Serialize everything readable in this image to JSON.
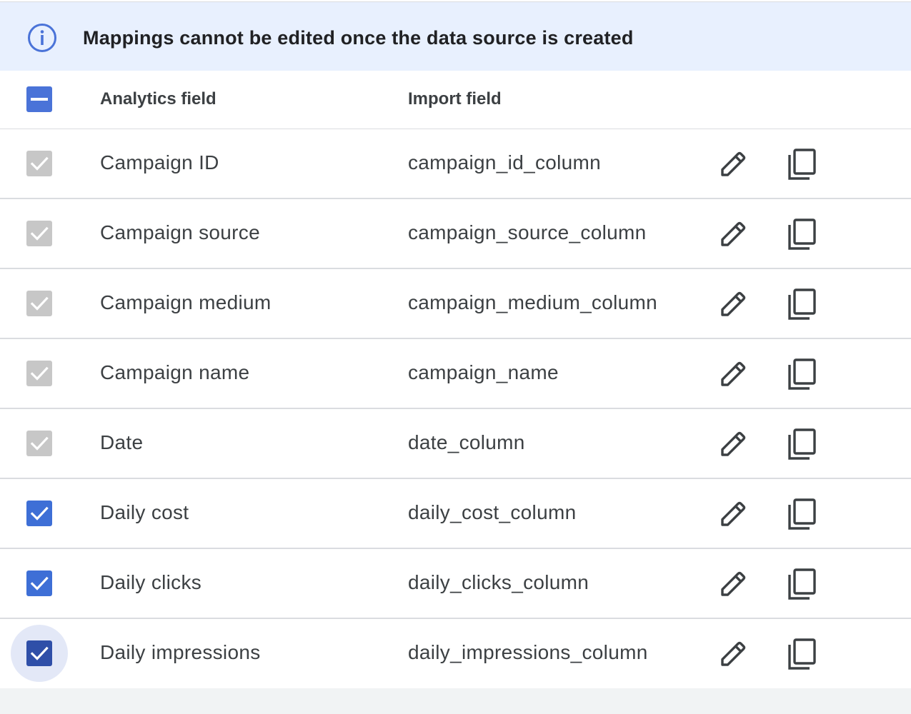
{
  "banner": {
    "icon": "info-icon",
    "text": "Mappings cannot be edited once the data source is created",
    "background": "#e8f0fe",
    "icon_color": "#4a73d8"
  },
  "table": {
    "select_all_state": "indeterminate",
    "columns": {
      "analytics": "Analytics field",
      "import": "Import field"
    },
    "rows": [
      {
        "analytics": "Campaign ID",
        "import": "campaign_id_column",
        "state": "disabled"
      },
      {
        "analytics": "Campaign source",
        "import": "campaign_source_column",
        "state": "disabled"
      },
      {
        "analytics": "Campaign medium",
        "import": "campaign_medium_column",
        "state": "disabled"
      },
      {
        "analytics": "Campaign name",
        "import": "campaign_name",
        "state": "disabled"
      },
      {
        "analytics": "Date",
        "import": "date_column",
        "state": "disabled"
      },
      {
        "analytics": "Daily cost",
        "import": "daily_cost_column",
        "state": "checked"
      },
      {
        "analytics": "Daily clicks",
        "import": "daily_clicks_column",
        "state": "checked"
      },
      {
        "analytics": "Daily impressions",
        "import": "daily_impressions_column",
        "state": "focused"
      }
    ],
    "row_actions": [
      "pencil-icon",
      "copy-icon"
    ],
    "colors": {
      "checked": "#3e6fd6",
      "disabled": "#c7c7c7",
      "focused": "#2f4fa8"
    }
  }
}
